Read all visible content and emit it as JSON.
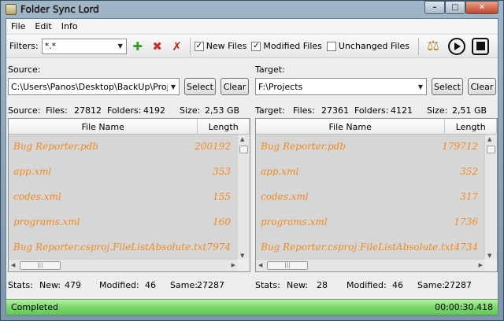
{
  "window": {
    "title": "Folder Sync Lord"
  },
  "menu": [
    "File",
    "Edit",
    "Info"
  ],
  "toolbar": {
    "filters_label": "Filters:",
    "filters_value": "*.*",
    "new_files": {
      "label": "New Files",
      "checked": true
    },
    "modified_files": {
      "label": "Modified Files",
      "checked": true
    },
    "unchanged_files": {
      "label": "Unchanged Files",
      "checked": false
    }
  },
  "source": {
    "label": "Source:",
    "path": "C:\\Users\\Panos\\Desktop\\BackUp\\Projects",
    "select_label": "Select",
    "clear_label": "Clear",
    "summary": {
      "label": "Source:",
      "files_label": "Files:",
      "files": "27812",
      "folders_label": "Folders:",
      "folders": "4192",
      "size_label": "Size:",
      "size": "2,53 GB"
    },
    "columns": [
      "File Name",
      "Length"
    ],
    "rows": [
      {
        "name": "Bug Reporter.pdb",
        "length": "200192"
      },
      {
        "name": "app.xml",
        "length": "353"
      },
      {
        "name": "codes.xml",
        "length": "155"
      },
      {
        "name": "programs.xml",
        "length": "160"
      },
      {
        "name": "Bug Reporter.csproj.FileListAbsolute.txt",
        "length": "7974"
      }
    ],
    "stats": {
      "label": "Stats:",
      "new_label": "New:",
      "new": "479",
      "modified_label": "Modified:",
      "modified": "46",
      "same_label": "Same:",
      "same": "27287"
    }
  },
  "target": {
    "label": "Target:",
    "path": "F:\\Projects",
    "select_label": "Select",
    "clear_label": "Clear",
    "summary": {
      "label": "Target:",
      "files_label": "Files:",
      "files": "27361",
      "folders_label": "Folders:",
      "folders": "4121",
      "size_label": "Size:",
      "size": "2,51 GB"
    },
    "columns": [
      "File Name",
      "Length"
    ],
    "rows": [
      {
        "name": "Bug Reporter.pdb",
        "length": "179712"
      },
      {
        "name": "app.xml",
        "length": "352"
      },
      {
        "name": "codes.xml",
        "length": "317"
      },
      {
        "name": "programs.xml",
        "length": "1736"
      },
      {
        "name": "Bug Reporter.csproj.FileListAbsolute.txt",
        "length": "4734"
      }
    ],
    "stats": {
      "label": "Stats:",
      "new_label": "New:",
      "new": "28",
      "modified_label": "Modified:",
      "modified": "46",
      "same_label": "Same:",
      "same": "27287"
    }
  },
  "status": {
    "text": "Completed",
    "elapsed": "00:00:30.418"
  },
  "colors": {
    "file_text": "#f08a1e",
    "status_green": "#7bd66c"
  }
}
